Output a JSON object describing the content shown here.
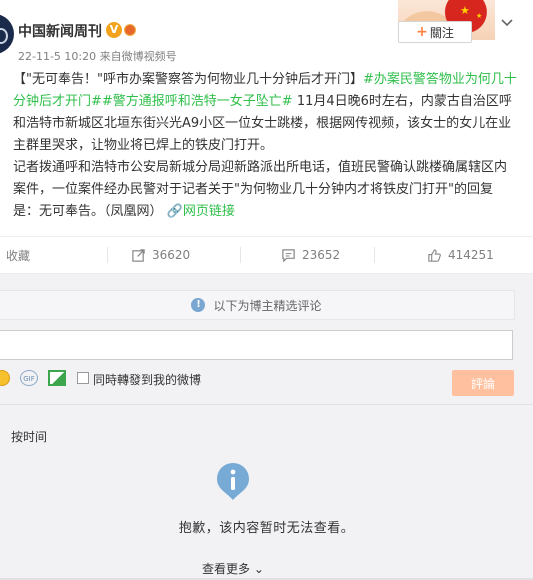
{
  "post": {
    "username": "中国新闻周刊",
    "meta": "22-11-5 10:20 来自微博视频号",
    "follow_label": "關注",
    "content": {
      "title_quote": "【\"无可奉告！\"呼市办案警察答为何物业几十分钟后才开门】",
      "hashtag1": "#办案民警答物业为何几十分钟后才开门#",
      "hashtag2": "#警方通报呼和浩特一女子坠亡#",
      "para1_rest": " 11月4日晚6时左右，内蒙古自治区呼和浩特市新城区北垣东街兴光A9小区一位女士跳楼，根据网传视频，该女士的女儿在业主群里哭求，让物业将已焊上的铁皮门打开。",
      "para2": "记者拨通呼和浩特市公安局新城分局迎新路派出所电话，值班民警确认跳楼确属辖区内案件，一位案件经办民警对于记者关于\"为何物业几十分钟内才将铁皮门打开\"的回复是：无可奉告。（凤凰网）",
      "link_label": "网页链接"
    }
  },
  "actions": {
    "favorite_label": "收藏",
    "repost_count": "36620",
    "comment_count": "23652",
    "like_count": "414251"
  },
  "comments": {
    "notice": "以下为博主精选评论",
    "input_placeholder": "",
    "repost_checkbox_label": "同時轉發到我的微博",
    "submit_label": "評論",
    "sort_label": "按时间",
    "empty_message": "抱歉，该内容暂时无法查看。",
    "more_label": "查看更多"
  },
  "colors": {
    "hashtag": "#2fbf4a",
    "submit_bg": "#ffc09f",
    "accent_orange": "#ff8140"
  }
}
